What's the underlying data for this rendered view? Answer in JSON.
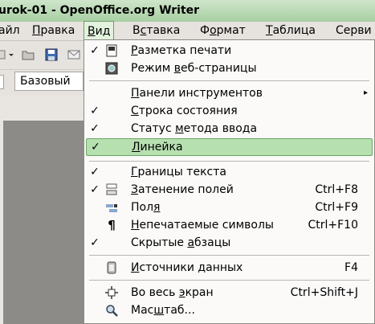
{
  "window": {
    "title": "urok-01 - OpenOffice.org Writer"
  },
  "menubar": [
    {
      "label": "айл",
      "ul": ""
    },
    {
      "label": "Правка",
      "ul": "П"
    },
    {
      "label": "Вид",
      "ul": "В"
    },
    {
      "label": "Вставка",
      "ul": "с"
    },
    {
      "label": "Формат",
      "ul": "о"
    },
    {
      "label": "Таблица",
      "ul": "Т"
    },
    {
      "label": "Серви",
      "ul": ""
    }
  ],
  "toolbar": {
    "style_value": "Базовый"
  },
  "view_menu": {
    "items": [
      {
        "pre": "",
        "u": "Р",
        "post": "азметка печати",
        "checked": true,
        "icon": "print-layout-icon",
        "shortcut": ""
      },
      {
        "pre": "Режим ",
        "u": "в",
        "post": "еб-страницы",
        "checked": false,
        "icon": "web-layout-icon",
        "shortcut": ""
      },
      {
        "pre": "",
        "u": "П",
        "post": "анели инструментов",
        "checked": false,
        "icon": "",
        "shortcut": "",
        "submenu": true
      },
      {
        "pre": "",
        "u": "С",
        "post": "трока состояния",
        "checked": true,
        "icon": "",
        "shortcut": ""
      },
      {
        "pre": "Статус ",
        "u": "м",
        "post": "етода ввода",
        "checked": true,
        "icon": "",
        "shortcut": ""
      },
      {
        "pre": "",
        "u": "Л",
        "post": "инейка",
        "checked": true,
        "icon": "",
        "shortcut": "",
        "highlighted": true
      },
      {
        "pre": "",
        "u": "Г",
        "post": "раницы текста",
        "checked": true,
        "icon": "",
        "shortcut": ""
      },
      {
        "pre": "",
        "u": "З",
        "post": "атенение полей",
        "checked": true,
        "icon": "field-shading-icon",
        "shortcut": "Ctrl+F8"
      },
      {
        "pre": "Пол",
        "u": "я",
        "post": "",
        "checked": false,
        "icon": "fields-icon",
        "shortcut": "Ctrl+F9"
      },
      {
        "pre": "",
        "u": "Н",
        "post": "епечатаемые символы",
        "checked": false,
        "icon": "pilcrow-icon",
        "shortcut": "Ctrl+F10"
      },
      {
        "pre": "Скрытые ",
        "u": "а",
        "post": "бзацы",
        "checked": true,
        "icon": "",
        "shortcut": ""
      },
      {
        "pre": "",
        "u": "И",
        "post": "сточники данных",
        "checked": false,
        "icon": "data-sources-icon",
        "shortcut": "F4"
      },
      {
        "pre": "Во весь ",
        "u": "э",
        "post": "кран",
        "checked": false,
        "icon": "fullscreen-icon",
        "shortcut": "Ctrl+Shift+J"
      },
      {
        "pre": "Мас",
        "u": "ш",
        "post": "таб...",
        "checked": false,
        "icon": "zoom-icon",
        "shortcut": ""
      }
    ],
    "check_glyph": "✓",
    "submenu_glyph": "▸"
  }
}
